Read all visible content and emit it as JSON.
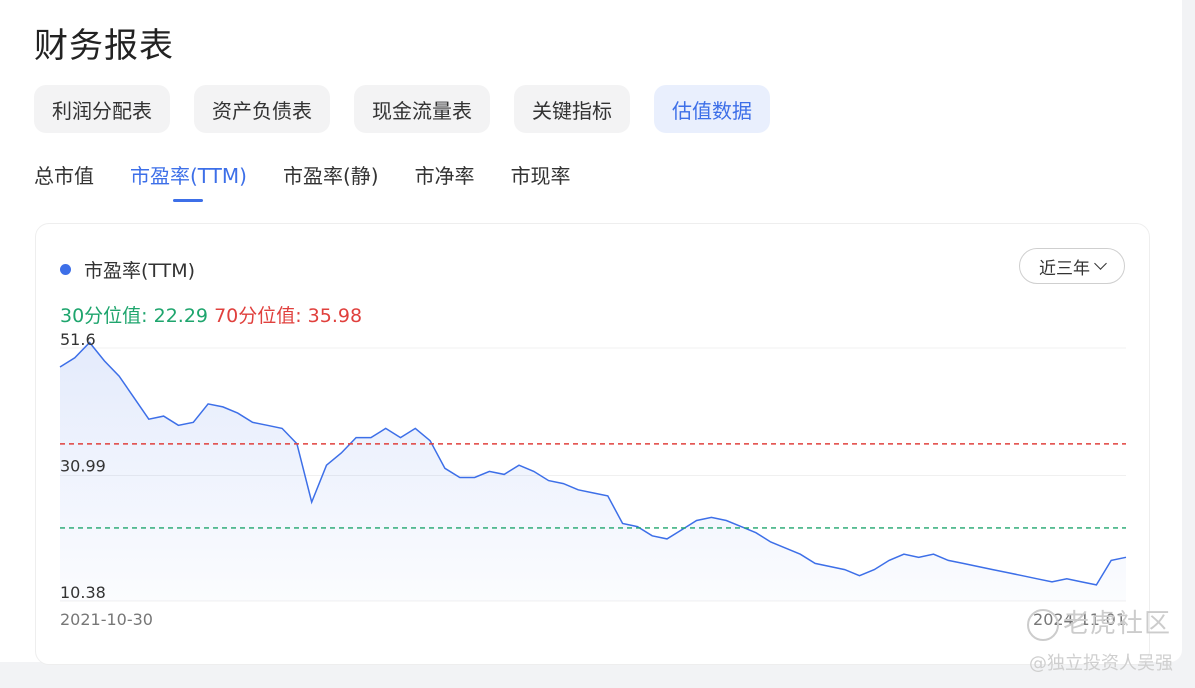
{
  "page_title": "财务报表",
  "tabs": [
    {
      "label": "利润分配表",
      "active": false
    },
    {
      "label": "资产负债表",
      "active": false
    },
    {
      "label": "现金流量表",
      "active": false
    },
    {
      "label": "关键指标",
      "active": false
    },
    {
      "label": "估值数据",
      "active": true
    }
  ],
  "subtabs": [
    {
      "label": "总市值",
      "active": false
    },
    {
      "label": "市盈率(TTM)",
      "active": true
    },
    {
      "label": "市盈率(静)",
      "active": false
    },
    {
      "label": "市净率",
      "active": false
    },
    {
      "label": "市现率",
      "active": false
    }
  ],
  "card": {
    "legend_label": "市盈率(TTM)",
    "range_label": "近三年",
    "p30_text": "30分位值: 22.29",
    "p70_text": "70分位值: 35.98"
  },
  "colors": {
    "accent": "#3d6fe8",
    "p30": "#1ea56d",
    "p70": "#e0403d"
  },
  "watermark": {
    "main": "老虎社区",
    "sub": "@独立投资人吴强"
  },
  "chart_data": {
    "type": "area",
    "series": [
      {
        "name": "市盈率(TTM)",
        "x": [
          "2021-10-30",
          "2021-11-15",
          "2021-12-01",
          "2021-12-15",
          "2022-01-01",
          "2022-01-15",
          "2022-02-01",
          "2022-02-15",
          "2022-03-01",
          "2022-03-15",
          "2022-04-01",
          "2022-04-15",
          "2022-05-01",
          "2022-05-15",
          "2022-06-01",
          "2022-06-15",
          "2022-07-01",
          "2022-07-15",
          "2022-08-01",
          "2022-08-15",
          "2022-09-01",
          "2022-09-15",
          "2022-10-01",
          "2022-10-15",
          "2022-11-01",
          "2022-11-15",
          "2022-12-01",
          "2022-12-15",
          "2023-01-01",
          "2023-01-15",
          "2023-02-01",
          "2023-02-15",
          "2023-03-01",
          "2023-03-15",
          "2023-04-01",
          "2023-04-15",
          "2023-05-01",
          "2023-05-15",
          "2023-06-01",
          "2023-06-15",
          "2023-07-01",
          "2023-07-15",
          "2023-08-01",
          "2023-08-15",
          "2023-09-01",
          "2023-09-15",
          "2023-10-01",
          "2023-10-15",
          "2023-11-01",
          "2023-11-15",
          "2023-12-01",
          "2023-12-15",
          "2024-01-01",
          "2024-01-15",
          "2024-02-01",
          "2024-02-15",
          "2024-03-01",
          "2024-03-15",
          "2024-04-01",
          "2024-04-15",
          "2024-05-01",
          "2024-05-15",
          "2024-06-01",
          "2024-06-15",
          "2024-07-01",
          "2024-07-15",
          "2024-08-01",
          "2024-08-15",
          "2024-09-01",
          "2024-09-15",
          "2024-10-01",
          "2024-10-15",
          "2024-11-01"
        ],
        "values": [
          48.5,
          50.0,
          52.5,
          49.5,
          47.0,
          43.5,
          40.0,
          40.5,
          39.0,
          39.5,
          42.5,
          42.0,
          41.0,
          39.5,
          39.0,
          38.5,
          36.0,
          26.5,
          32.5,
          34.5,
          37.0,
          37.0,
          38.5,
          37.0,
          38.5,
          36.5,
          32.0,
          30.5,
          30.5,
          31.5,
          31.0,
          32.5,
          31.5,
          30.0,
          29.5,
          28.5,
          28.0,
          27.5,
          23.0,
          22.5,
          21.0,
          20.5,
          22.0,
          23.5,
          24.0,
          23.5,
          22.5,
          21.5,
          20.0,
          19.0,
          18.0,
          16.5,
          16.0,
          15.5,
          14.5,
          15.5,
          17.0,
          18.0,
          17.5,
          18.0,
          17.0,
          16.5,
          16.0,
          15.5,
          15.0,
          14.5,
          14.0,
          13.5,
          14.0,
          13.5,
          13.0,
          17.0,
          17.5
        ]
      }
    ],
    "y_ticks": [
      51.6,
      30.99,
      10.38
    ],
    "x_tick_labels": [
      "2021-10-30",
      "2024-11-01"
    ],
    "ylim": [
      10.38,
      51.6
    ],
    "reference_lines": [
      {
        "label": "30分位值",
        "value": 22.29,
        "color": "#1ea56d"
      },
      {
        "label": "70分位值",
        "value": 35.98,
        "color": "#e0403d"
      }
    ],
    "grid": true
  }
}
